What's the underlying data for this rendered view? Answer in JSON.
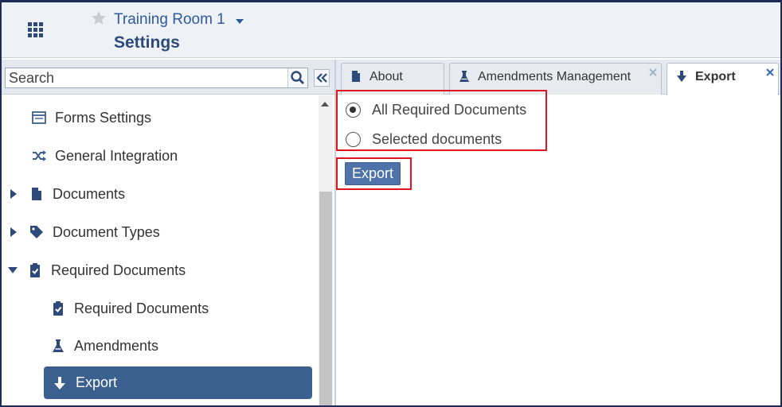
{
  "header": {
    "room_name": "Training Room 1",
    "page_title": "Settings"
  },
  "sidebar": {
    "search_placeholder": "Search",
    "items": [
      {
        "label": "Forms Settings",
        "icon": "form-icon"
      },
      {
        "label": "General Integration",
        "icon": "shuffle-icon"
      },
      {
        "label": "Documents",
        "icon": "document-icon",
        "expandable": true,
        "expanded": false
      },
      {
        "label": "Document Types",
        "icon": "tag-icon",
        "expandable": true,
        "expanded": false
      },
      {
        "label": "Required Documents",
        "icon": "clipboard-check-icon",
        "expandable": true,
        "expanded": true
      },
      {
        "label": "Required Documents",
        "icon": "clipboard-check-icon",
        "child": true
      },
      {
        "label": "Amendments",
        "icon": "flask-icon",
        "child": true
      },
      {
        "label": "Export",
        "icon": "arrow-down-icon",
        "child": true,
        "active": true
      }
    ]
  },
  "tabs": [
    {
      "label": "About",
      "icon": "document-icon",
      "closable": false,
      "active": false
    },
    {
      "label": "Amendments Management",
      "icon": "flask-icon",
      "closable": true,
      "active": false
    },
    {
      "label": "Export",
      "icon": "arrow-down-icon",
      "closable": true,
      "active": true
    }
  ],
  "content": {
    "options": [
      {
        "label": "All Required Documents",
        "selected": true
      },
      {
        "label": "Selected documents",
        "selected": false
      }
    ],
    "export_button": "Export"
  },
  "colors": {
    "accent": "#3b5f8f",
    "button": "#4f73a8",
    "highlight": "#e0151d"
  }
}
